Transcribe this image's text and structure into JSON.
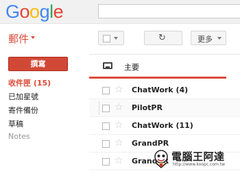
{
  "header": {
    "logo": {
      "letters": [
        "G",
        "o",
        "o",
        "g",
        "l",
        "e"
      ],
      "colors": [
        "#4285f4",
        "#ea4335",
        "#fbbc05",
        "#4285f4",
        "#34a853",
        "#ea4335"
      ]
    },
    "search": {
      "placeholder": ""
    }
  },
  "sidebar": {
    "mail_title": "郵件",
    "compose_label": "撰寫",
    "items": [
      {
        "label": "收件匣 (15)"
      },
      {
        "label": "已加星號"
      },
      {
        "label": "寄件備份"
      },
      {
        "label": "草稿"
      },
      {
        "label": "Notes"
      }
    ]
  },
  "toolbar": {
    "refresh_symbol": "↻",
    "more_label": "更多"
  },
  "tabs": {
    "primary_label": "主要"
  },
  "messages": [
    {
      "sender": "ChatWork (4)"
    },
    {
      "sender": "PilotPR"
    },
    {
      "sender": "ChatWork (11)"
    },
    {
      "sender": "GrandPR"
    },
    {
      "sender": "GrandPR"
    }
  ],
  "watermark": {
    "name": "電腦王阿達",
    "url": "http://www.koopc.com.tw"
  },
  "colors": {
    "accent": "#dd4b39",
    "compose": "#d14836"
  }
}
